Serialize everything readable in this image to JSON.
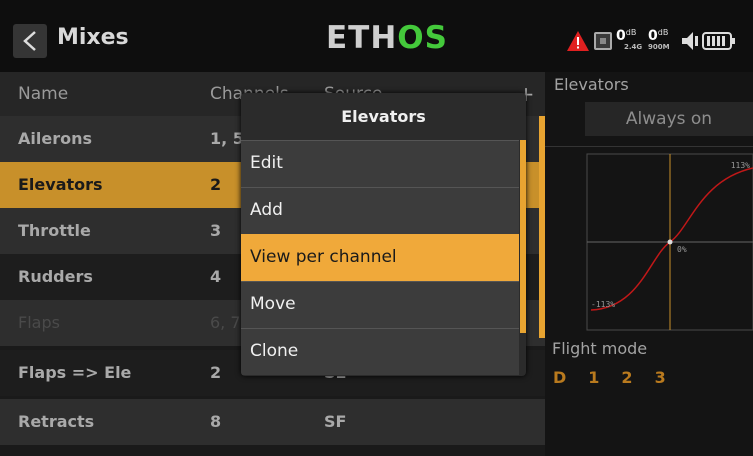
{
  "header": {
    "title": "Mixes",
    "logo_part1": "ETH",
    "logo_part2": "OS",
    "rssi_a": "0",
    "rssi_a_unit": "dB",
    "rssi_a_band": "2.4G",
    "rssi_b": "0",
    "rssi_b_unit": "dB",
    "rssi_b_band": "900M"
  },
  "list": {
    "columns": [
      "Name",
      "Channels",
      "Source"
    ],
    "add_label": "+",
    "rows": [
      {
        "name": "Ailerons",
        "channels": "1, 5",
        "source": ""
      },
      {
        "name": "Elevators",
        "channels": "2",
        "source": ""
      },
      {
        "name": "Throttle",
        "channels": "3",
        "source": ""
      },
      {
        "name": "Rudders",
        "channels": "4",
        "source": ""
      },
      {
        "name": "Flaps",
        "channels": "6, 7",
        "source": ""
      },
      {
        "name": "Flaps => Ele",
        "channels": "2",
        "source": "SE"
      },
      {
        "name": "Retracts",
        "channels": "8",
        "source": "SF"
      }
    ]
  },
  "popup": {
    "title": "Elevators",
    "items": [
      "Edit",
      "Add",
      "View per channel",
      "Move",
      "Clone"
    ],
    "highlighted": "View per channel"
  },
  "right_panel": {
    "title": "Elevators",
    "active_condition": "Always on",
    "curve_top_label": "113%",
    "curve_center_label": "0%",
    "curve_bottom_label": "-113%",
    "flight_mode_title": "Flight mode",
    "flight_modes": [
      "D",
      "1",
      "2",
      "3"
    ]
  },
  "colors": {
    "accent": "#f0a93a",
    "selected_row": "#c8902a",
    "logo_green": "#44c93b",
    "warning_red": "#e02020"
  },
  "icons": {
    "back": "chevron-left-icon",
    "warning": "warning-triangle-icon",
    "recorder": "sd-card-icon",
    "volume": "speaker-icon",
    "battery": "battery-icon"
  }
}
